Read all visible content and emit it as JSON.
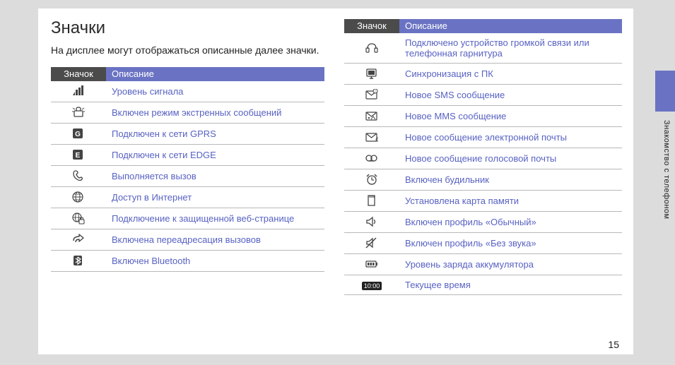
{
  "title": "Значки",
  "subtitle": "На дисплее могут отображаться описанные далее значки.",
  "table_headers": {
    "icon": "Значок",
    "desc": "Описание"
  },
  "vertical_label": "Знакомство с телефоном",
  "page_number": "15",
  "clock_text": "10:00",
  "left_rows": [
    {
      "icon": "signal-icon",
      "desc": "Уровень сигнала"
    },
    {
      "icon": "sos-icon",
      "desc": "Включен режим экстренных сообщений"
    },
    {
      "icon": "gprs-icon",
      "desc": "Подключен к сети GPRS"
    },
    {
      "icon": "edge-icon",
      "desc": "Подключен к сети EDGE"
    },
    {
      "icon": "call-icon",
      "desc": "Выполняется вызов"
    },
    {
      "icon": "globe-icon",
      "desc": "Доступ в Интернет"
    },
    {
      "icon": "secure-web-icon",
      "desc": "Подключение к защищенной веб-странице"
    },
    {
      "icon": "forward-icon",
      "desc": "Включена переадресация вызовов"
    },
    {
      "icon": "bluetooth-icon",
      "desc": "Включен Bluetooth"
    }
  ],
  "right_rows": [
    {
      "icon": "handsfree-icon",
      "desc": "Подключено устройство громкой связи или телефонная гарнитура"
    },
    {
      "icon": "pc-sync-icon",
      "desc": "Синхронизация с ПК"
    },
    {
      "icon": "sms-icon",
      "desc": "Новое SMS сообщение"
    },
    {
      "icon": "mms-icon",
      "desc": "Новое MMS сообщение"
    },
    {
      "icon": "email-icon",
      "desc": "Новое сообщение электронной почты"
    },
    {
      "icon": "voicemail-icon",
      "desc": "Новое сообщение голосовой почты"
    },
    {
      "icon": "alarm-icon",
      "desc": "Включен будильник"
    },
    {
      "icon": "memory-card-icon",
      "desc": "Установлена карта памяти"
    },
    {
      "icon": "speaker-icon",
      "desc": "Включен профиль «Обычный»"
    },
    {
      "icon": "mute-icon",
      "desc": "Включен профиль «Без звука»"
    },
    {
      "icon": "battery-icon",
      "desc": "Уровень заряда аккумулятора"
    },
    {
      "icon": "clock-icon",
      "desc": "Текущее время"
    }
  ]
}
